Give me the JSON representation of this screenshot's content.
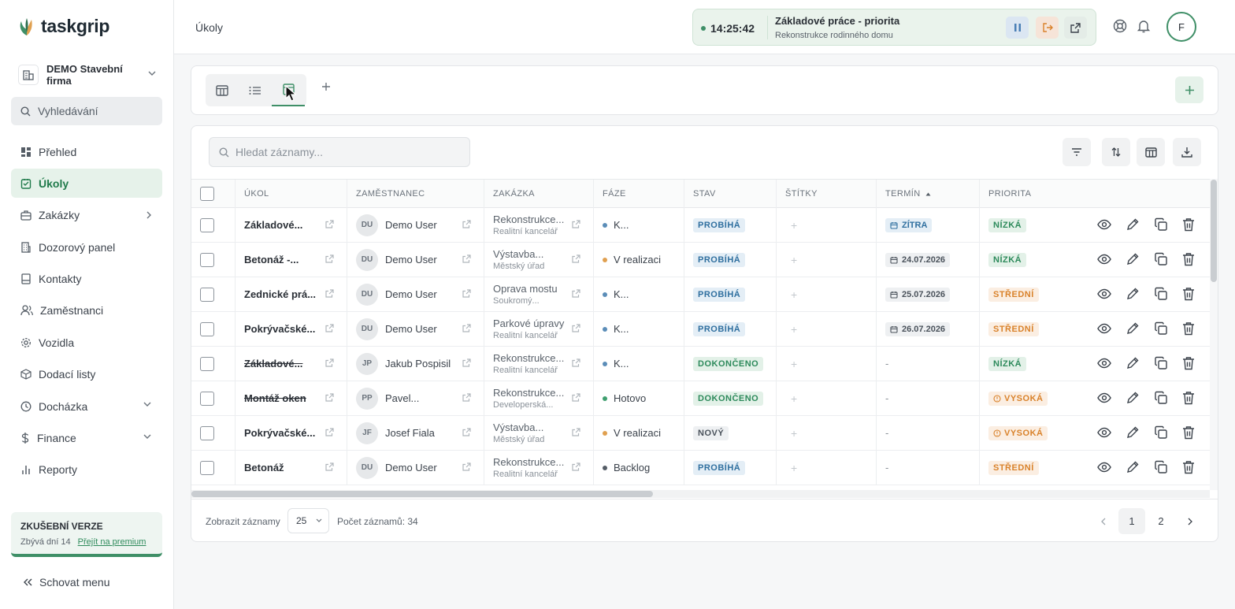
{
  "app": {
    "logo": "taskgrip"
  },
  "sidebar": {
    "company": "DEMO Stavební firma",
    "search_label": "Vyhledávání",
    "items": [
      {
        "label": "Přehled",
        "icon": "dashboard-icon",
        "active": false
      },
      {
        "label": "Úkoly",
        "icon": "task-icon",
        "active": true
      },
      {
        "label": "Zakázky",
        "icon": "briefcase-icon",
        "active": false,
        "chevron": "right"
      },
      {
        "label": "Dozorový panel",
        "icon": "building-icon",
        "active": false
      },
      {
        "label": "Kontakty",
        "icon": "contacts-icon",
        "active": false
      },
      {
        "label": "Zaměstnanci",
        "icon": "users-icon",
        "active": false
      },
      {
        "label": "Vozidla",
        "icon": "gear-icon",
        "active": false
      },
      {
        "label": "Dodací listy",
        "icon": "package-icon",
        "active": false
      },
      {
        "label": "Docházka",
        "icon": "clock-icon",
        "active": false,
        "chevron": "down"
      },
      {
        "label": "Finance",
        "icon": "dollar-icon",
        "active": false,
        "chevron": "down"
      },
      {
        "label": "Reporty",
        "icon": "chart-icon",
        "active": false
      }
    ],
    "trial": {
      "title": "ZKUŠEBNÍ VERZE",
      "days_left": "Zbývá dní 14",
      "premium_link": "Přejít na premium"
    },
    "hide_menu": "Schovat menu"
  },
  "topbar": {
    "page_title": "Úkoly",
    "timer": {
      "time": "14:25:42",
      "task": "Základové práce - priorita",
      "project": "Rekonstrukce rodinného domu"
    },
    "user_initial": "F"
  },
  "colors": {
    "accent": "#3f8f67",
    "accent_light": "#e6f2ea",
    "status_blue": "#2f6f9f",
    "status_green": "#2d8a5b",
    "priority_orange": "#d9822b"
  },
  "table": {
    "search_placeholder": "Hledat záznamy...",
    "columns": [
      "ÚKOL",
      "ZAMĚSTNANEC",
      "ZAKÁZKA",
      "FÁZE",
      "STAV",
      "ŠTÍTKY",
      "TERMÍN",
      "PRIORITA"
    ],
    "rows": [
      {
        "task": "Základové...",
        "strike": false,
        "initials": "DU",
        "employee": "Demo User",
        "project": "Rekonstrukce...",
        "client": "Realitní kancelář",
        "phase": "K...",
        "phase_color": "#5b8db8",
        "status": "PROBÍHÁ",
        "status_type": "blue",
        "date": "ZÍTRA",
        "date_type": "tomorrow",
        "priority": "NÍZKÁ",
        "priority_type": "low"
      },
      {
        "task": "Betonáž -...",
        "strike": false,
        "initials": "DU",
        "employee": "Demo User",
        "project": "Výstavba...",
        "client": "Městský úřad",
        "phase": "V realizaci",
        "phase_color": "#e0a050",
        "status": "PROBÍHÁ",
        "status_type": "blue",
        "date": "24.07.2026",
        "date_type": "date",
        "priority": "NÍZKÁ",
        "priority_type": "low"
      },
      {
        "task": "Zednické prá...",
        "strike": false,
        "initials": "DU",
        "employee": "Demo User",
        "project": "Oprava mostu",
        "client": "Soukromý...",
        "phase": "K...",
        "phase_color": "#5b8db8",
        "status": "PROBÍHÁ",
        "status_type": "blue",
        "date": "25.07.2026",
        "date_type": "date",
        "priority": "STŘEDNÍ",
        "priority_type": "medium"
      },
      {
        "task": "Pokrývačské...",
        "strike": false,
        "initials": "DU",
        "employee": "Demo User",
        "project": "Parkové úpravy",
        "client": "Realitní kancelář",
        "phase": "K...",
        "phase_color": "#5b8db8",
        "status": "PROBÍHÁ",
        "status_type": "blue",
        "date": "26.07.2026",
        "date_type": "date",
        "priority": "STŘEDNÍ",
        "priority_type": "medium"
      },
      {
        "task": "Základové...",
        "strike": true,
        "initials": "JP",
        "employee": "Jakub Pospisil",
        "project": "Rekonstrukce...",
        "client": "Realitní kancelář",
        "phase": "K...",
        "phase_color": "#5b8db8",
        "status": "DOKONČENO",
        "status_type": "green",
        "date": "-",
        "date_type": "none",
        "priority": "NÍZKÁ",
        "priority_type": "low"
      },
      {
        "task": "Montáž oken",
        "strike": true,
        "initials": "PP",
        "employee": "Pavel...",
        "project": "Rekonstrukce...",
        "client": "Developerská...",
        "phase": "Hotovo",
        "phase_color": "#3f9f6f",
        "status": "DOKONČENO",
        "status_type": "green",
        "date": "-",
        "date_type": "none",
        "priority": "VYSOKÁ",
        "priority_type": "high"
      },
      {
        "task": "Pokrývačské...",
        "strike": false,
        "initials": "JF",
        "employee": "Josef Fiala",
        "project": "Výstavba...",
        "client": "Městský úřad",
        "phase": "V realizaci",
        "phase_color": "#e0a050",
        "status": "NOVÝ",
        "status_type": "gray",
        "date": "-",
        "date_type": "none",
        "priority": "VYSOKÁ",
        "priority_type": "high"
      },
      {
        "task": "Betonáž",
        "strike": false,
        "initials": "DU",
        "employee": "Demo User",
        "project": "Rekonstrukce...",
        "client": "Realitní kancelář",
        "phase": "Backlog",
        "phase_color": "#555d66",
        "status": "PROBÍHÁ",
        "status_type": "blue",
        "date": "-",
        "date_type": "none",
        "priority": "STŘEDNÍ",
        "priority_type": "medium"
      }
    ]
  },
  "footer": {
    "show_label": "Zobrazit záznamy",
    "page_size": "25",
    "count_label": "Počet záznamů: 34",
    "pages": [
      "1",
      "2"
    ],
    "current_page": "1"
  }
}
